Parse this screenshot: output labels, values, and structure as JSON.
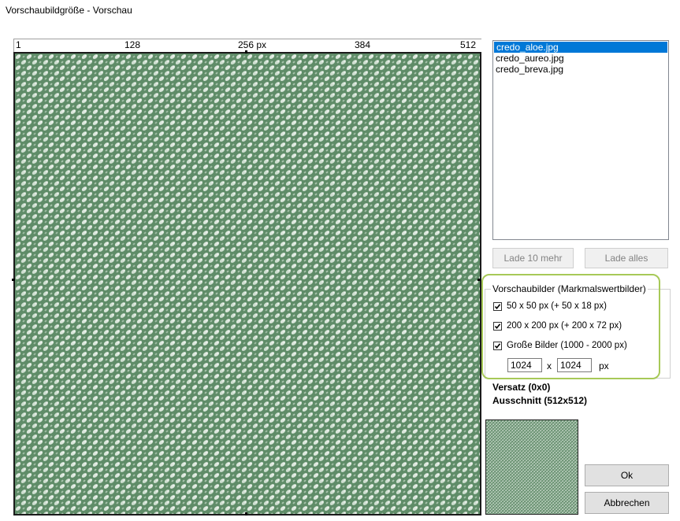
{
  "window": {
    "title": "Vorschaubildgröße - Vorschau"
  },
  "ruler": {
    "labels": [
      "1",
      "128",
      "256 px",
      "384",
      "512"
    ]
  },
  "files": {
    "items": [
      "credo_aloe.jpg",
      "credo_aureo.jpg",
      "credo_breva.jpg"
    ],
    "selected_index": 0
  },
  "buttons": {
    "load_more": "Lade 10 mehr",
    "load_all": "Lade alles",
    "ok": "Ok",
    "cancel": "Abbrechen"
  },
  "thumbnails": {
    "legend": "Vorschaubilder (Markmalswertbilder)",
    "options": [
      {
        "label": "50 x 50 px (+ 50 x 18 px)",
        "checked": true
      },
      {
        "label": "200 x 200 px (+ 200 x 72 px)",
        "checked": true
      },
      {
        "label": "Große Bilder (1000 - 2000 px)",
        "checked": true
      }
    ],
    "width": "1024",
    "x_sep": "x",
    "height": "1024",
    "unit": "px"
  },
  "info": {
    "offset": "Versatz (0x0)",
    "crop": "Ausschnitt (512x512)"
  },
  "colors": {
    "texture_base": "#5f8c68",
    "texture_light": "#dbe7dc",
    "selection": "#0078d7",
    "highlight": "#a7c958"
  }
}
